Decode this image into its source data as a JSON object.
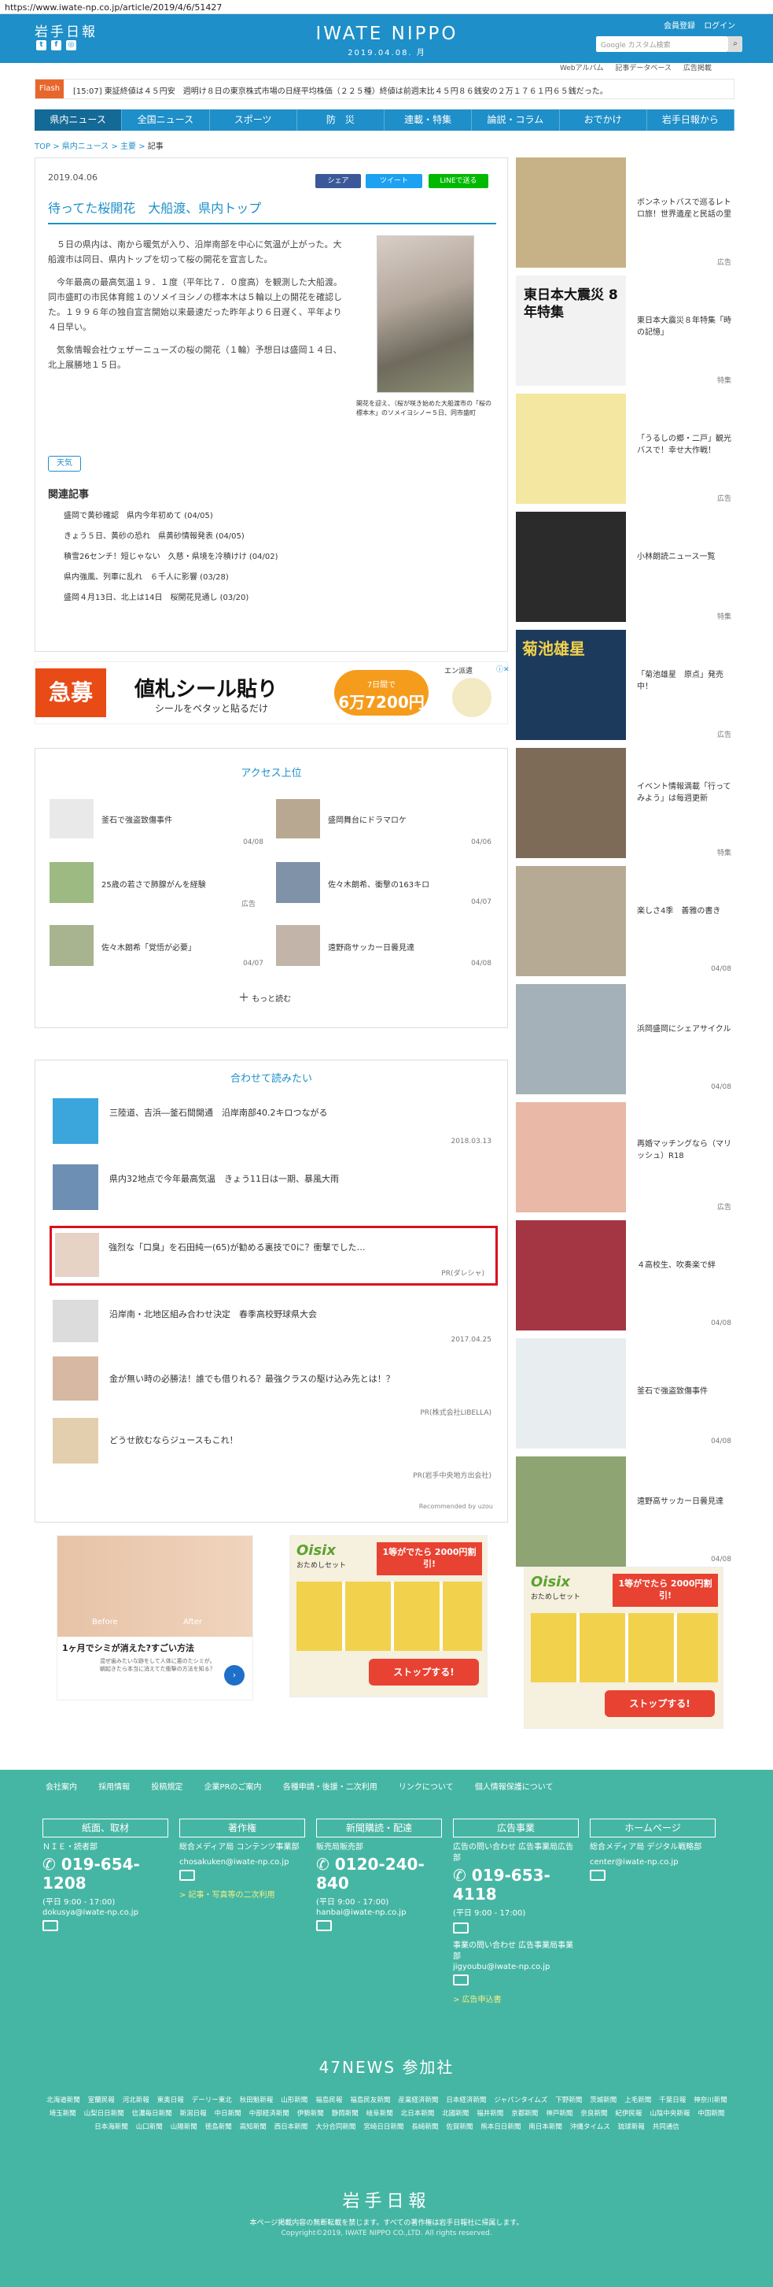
{
  "browser": {
    "url": "https://www.iwate-np.co.jp/article/2019/4/6/51427"
  },
  "header": {
    "logo": "岩手日報",
    "brand": "IWATE NIPPO",
    "date": "2019.04.08. 月",
    "links": [
      "会員登録",
      "ログイン"
    ],
    "search_placeholder": "Google カスタム検索",
    "social_icons": [
      "twitter-icon",
      "facebook-icon",
      "instagram-icon"
    ]
  },
  "subnav": [
    "Webアルバム",
    "記事データベース",
    "広告掲載"
  ],
  "flash": {
    "label": "Flash",
    "text": "[15:07] 東証終値は４５円安　週明け８日の東京株式市場の日経平均株価（２２５種）終値は前週末比４５円８６銭安の２万１７６１円６５銭だった。"
  },
  "mainnav": [
    "県内ニュース",
    "全国ニュース",
    "スポーツ",
    "防　災",
    "連載・特集",
    "論説・コラム",
    "おでかけ",
    "岩手日報から"
  ],
  "breadcrumb": [
    "TOP",
    "県内ニュース",
    "主要",
    "記事"
  ],
  "article": {
    "date": "2019.04.06",
    "share": [
      "シェア",
      "ツイート",
      "LINEで送る"
    ],
    "title": "待ってた桜開花　大船渡、県内トップ",
    "paragraphs": [
      "５日の県内は、南から暖気が入り、沿岸南部を中心に気温が上がった。大船渡市は同日、県内トップを切って桜の開花を宣言した。",
      "今年最高の最高気温１９．１度（平年比７．０度高）を観測した大船渡。同市盛町の市民体育館１のソメイヨシノの標本木は５輪以上の開花を確認した。１９９６年の独自宣言開始以来最速だった昨年より６日遅く、平年より４日早い。",
      "気象情報会社ウェザーニューズの桜の開花（１輪）予想日は盛岡１４日、北上展勝地１５日。"
    ],
    "caption": "開花を迎え、（桜が咲き始めた大船渡市の「桜の標本木」のソメイヨシノ＝５日、同市盛町",
    "weather": "天気",
    "related_heading": "関連記事",
    "related": [
      "盛岡で黄砂確認　県内今年初めて (04/05)",
      "きょう５日、黄砂の恐れ　県黄砂情報発表 (04/05)",
      "積雪26センチ！短じゃない　久慈・県境を冷積けけ (04/02)",
      "県内強風、列車に乱れ　６千人に影響 (03/28)",
      "盛岡４月13日、北上は14日　桜開花見通し (03/20)"
    ]
  },
  "ad_banner": {
    "badge": "急募",
    "headline": "値札シール貼り",
    "sub": "シールをペタッと貼るだけ",
    "pill_top": "7日間で",
    "pill_main": "6万7200円",
    "brand": "エン派遣"
  },
  "ranking": {
    "heading": "アクセス上位",
    "items": [
      {
        "title": "釜石で強盗致傷事件",
        "date": "04/08"
      },
      {
        "title": "盛岡舞台にドラマロケ",
        "date": "04/06"
      },
      {
        "title": "25歳の若さで肺腺がんを経験",
        "date": "広告"
      },
      {
        "title": "佐々木朗希、衝撃の163キロ",
        "date": "04/07"
      },
      {
        "title": "佐々木朗希「覚悟が必要」",
        "date": "04/07"
      },
      {
        "title": "遠野商サッカー日曇見達",
        "date": "04/08"
      }
    ],
    "more": "もっと読む"
  },
  "recommend": {
    "heading": "合わせて読みたい",
    "items": [
      {
        "title": "三陸道、吉浜―釜石間開通　沿岸南部40.2キロつながる",
        "src": "2018.03.13"
      },
      {
        "title": "県内32地点で今年最高気温　きょう11日は一期、暴風大雨",
        "src": ""
      },
      {
        "title": "強烈な「口臭」を石田純一(65)が勧める裏技で0に？衝撃でした…",
        "src": "PR(ダレシャ)"
      },
      {
        "title": "沿岸南・北地区組み合わせ決定　春季高校野球県大会",
        "src": "2017.04.25"
      },
      {
        "title": "金が無い時の必勝法！誰でも借りれる？最強クラスの駆け込み先とは！？",
        "src": "PR(株式会社LIBELLA)"
      },
      {
        "title": "どうせ飲むならジュースもこれ！",
        "src": "PR(岩手中央地方出会社)"
      }
    ],
    "recommended_by": "Recommended by uzou"
  },
  "sidebar": [
    {
      "text": "ボンネットバスで巡るレトロ旅！世界遺産と民話の里",
      "tag": "広告"
    },
    {
      "text": "東日本大震災８年特集「時の記憶」",
      "tag": "特集",
      "img_title": "東日本大震災 8年特集"
    },
    {
      "text": "「うるしの郷・二戸」観光バスで！幸せ大作戦！",
      "tag": "広告"
    },
    {
      "text": "小林朗読ニュース一覧",
      "tag": "特集"
    },
    {
      "text": "「菊池雄星　原点」発売中！",
      "tag": "広告",
      "img_title": "菊池雄星"
    },
    {
      "text": "イベント情報満載「行ってみよう」は每週更新",
      "tag": "特集"
    },
    {
      "text": "楽しさ4季　善雅の書き",
      "tag": "04/08"
    },
    {
      "text": "浜岡盛岡にシェアサイクル",
      "tag": "04/08"
    },
    {
      "text": "再婚マッチングなら（マリッシュ）R18",
      "tag": "広告"
    },
    {
      "text": "４高校生、吹奏楽で絆",
      "tag": "04/08"
    },
    {
      "text": "釜石で強盗致傷事件",
      "tag": "04/08"
    },
    {
      "text": "遠野高サッカー日曇見達",
      "tag": "04/08"
    }
  ],
  "bottom_ads": {
    "ad1_before": "Before",
    "ad1_after": "After",
    "ad1_title": "1ヶ月でシミが消えた?すごい方法",
    "ad1_text": "混ぜ歯みたいな跡をして人体に悪のたシミが。朝起きたら本当に消えてた衝撃の方法を知る？",
    "oisix_brand": "Oisix",
    "oisix_top": "おためしセット",
    "oisix_badge": "1等がでたら 2000円割引!",
    "oisix_btn": "ストップする!"
  },
  "footer": {
    "links": [
      "会社案内",
      "採用情報",
      "投稿規定",
      "企業PRのご案内",
      "各種申請・後援・二次利用",
      "リンクについて",
      "個人情報保護について"
    ],
    "cols": [
      {
        "head": "紙面、取材",
        "label": "ＮＩＥ・読者部",
        "tel": "019-654-1208",
        "hours": "(平日 9:00 - 17:00)",
        "mail": "dokusya@iwate-np.co.jp"
      },
      {
        "head": "著作権",
        "label": "総合メディア局 コンテンツ事業部",
        "tel": "",
        "hours": "",
        "mail": "chosakuken@iwate-np.co.jp",
        "link": "> 記事・写真等の二次利用"
      },
      {
        "head": "新聞購読・配達",
        "label": "販売局販売部",
        "tel": "0120-240-840",
        "hours": "(平日 9:00 - 17:00)",
        "mail": "hanbai@iwate-np.co.jp"
      },
      {
        "head": "広告事業",
        "label": "広告の問い合わせ 広告事業局広告部",
        "tel": "019-653-4118",
        "hours": "(平日 9:00 - 17:00)",
        "mail": "jigyoubu@iwate-np.co.jp",
        "label2": "事業の問い合わせ 広告事業局事業部",
        "link": "> 広告申込書"
      },
      {
        "head": "ホームページ",
        "label": "総合メディア局 デジタル戦略部",
        "tel": "",
        "hours": "",
        "mail": "center@iwate-np.co.jp"
      }
    ],
    "news47": "47NEWS 参加社",
    "papers": [
      "北海道新聞",
      "室蘭民報",
      "河北新報",
      "東奥日報",
      "デーリー東北",
      "秋田魁新報",
      "山形新聞",
      "福島民報",
      "福島民友新聞",
      "産業経済新聞",
      "日本経済新聞",
      "ジャパンタイムズ",
      "下野新聞",
      "茨城新聞",
      "上毛新聞",
      "千葉日報",
      "神奈川新聞",
      "埼玉新聞",
      "山梨日日新聞",
      "信濃毎日新聞",
      "新潟日報",
      "中日新聞",
      "中部経済新聞",
      "伊勢新聞",
      "静岡新聞",
      "岐阜新聞",
      "北日本新聞",
      "北國新聞",
      "福井新聞",
      "京都新聞",
      "神戸新聞",
      "奈良新聞",
      "紀伊民報",
      "山陰中央新報",
      "中国新聞",
      "日本海新聞",
      "山口新聞",
      "山陽新聞",
      "徳島新聞",
      "高知新聞",
      "西日本新聞",
      "大分合同新聞",
      "宮崎日日新聞",
      "長崎新聞",
      "佐賀新聞",
      "熊本日日新聞",
      "南日本新聞",
      "沖縄タイムス",
      "琉球新報",
      "共同通信"
    ],
    "logo": "岩手日報",
    "note": "本ページ掲載内容の無断転載を禁じます。すべての著作権は岩手日報社に帰属します。",
    "copyright": "Copyright©2019, IWATE NIPPO CO.,LTD. All rights reserved."
  },
  "colors": {
    "brand_blue": "#1e8fc8",
    "footer_green": "#46b6a4",
    "flash_orange": "#e8662b",
    "highlight_red": "#d8121b"
  }
}
